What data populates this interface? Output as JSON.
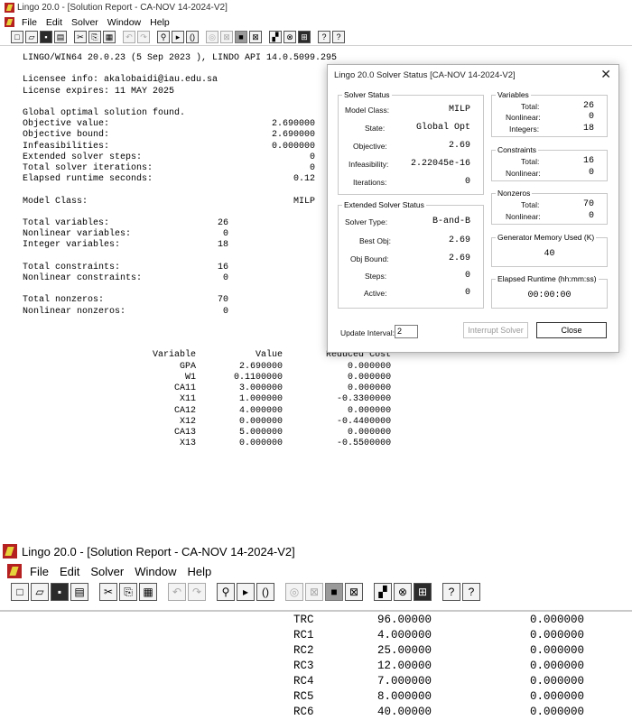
{
  "top": {
    "window_title": "Lingo 20.0 - [Solution Report - CA-NOV 14-2024-V2]",
    "menu": [
      "File",
      "Edit",
      "Solver",
      "Window",
      "Help"
    ],
    "report_lines": [
      "LINGO/WIN64 20.0.23 (5 Sep 2023 ), LINDO API 14.0.5099.295",
      "",
      "Licensee info: akalobaidi@iau.edu.sa",
      "License expires: 11 MAY 2025",
      "",
      "Global optimal solution found.",
      "Objective value:                              2.690000",
      "Objective bound:                              2.690000",
      "Infeasibilities:                              0.000000",
      "Extended solver steps:                               0",
      "Total solver iterations:                             0",
      "Elapsed runtime seconds:                          0.12",
      "",
      "Model Class:                                      MILP",
      "",
      "Total variables:                    26",
      "Nonlinear variables:                 0",
      "Integer variables:                  18",
      "",
      "Total constraints:                  16",
      "Nonlinear constraints:               0",
      "",
      "Total nonzeros:                     70",
      "Nonlinear nonzeros:                  0",
      "",
      "",
      "",
      "                        Variable           Value        Reduced Cost",
      "                             GPA        2.690000            0.000000",
      "                              W1       0.1100000            0.000000",
      "                            CA11        3.000000            0.000000",
      "                             X11        1.000000          -0.3300000",
      "                            CA12        4.000000            0.000000",
      "                             X12        0.000000          -0.4400000",
      "                            CA13        5.000000            0.000000",
      "                             X13        0.000000          -0.5500000"
    ]
  },
  "dialog": {
    "title": "Lingo 20.0 Solver Status [CA-NOV 14-2024-V2]",
    "close_glyph": "✕",
    "solver_status": {
      "legend": "Solver Status",
      "model_class_label": "Model Class:",
      "model_class": "MILP",
      "state_label": "State:",
      "state": "Global Opt",
      "objective_label": "Objective:",
      "objective": "2.69",
      "infeasibility_label": "Infeasibility:",
      "infeasibility": "2.22045e-16",
      "iterations_label": "Iterations:",
      "iterations": "0"
    },
    "extended": {
      "legend": "Extended Solver Status",
      "solver_type_label": "Solver Type:",
      "solver_type": "B-and-B",
      "best_obj_label": "Best Obj:",
      "best_obj": "2.69",
      "obj_bound_label": "Obj Bound:",
      "obj_bound": "2.69",
      "steps_label": "Steps:",
      "steps": "0",
      "active_label": "Active:",
      "active": "0"
    },
    "variables": {
      "legend": "Variables",
      "total_label": "Total:",
      "total": "26",
      "nonlinear_label": "Nonlinear:",
      "nonlinear": "0",
      "integers_label": "Integers:",
      "integers": "18"
    },
    "constraints": {
      "legend": "Constraints",
      "total_label": "Total:",
      "total": "16",
      "nonlinear_label": "Nonlinear:",
      "nonlinear": "0"
    },
    "nonzeros": {
      "legend": "Nonzeros",
      "total_label": "Total:",
      "total": "70",
      "nonlinear_label": "Nonlinear:",
      "nonlinear": "0"
    },
    "memory": {
      "legend": "Generator Memory Used (K)",
      "value": "40"
    },
    "runtime": {
      "legend": "Elapsed Runtime (hh:mm:ss)",
      "value": "00:00:00"
    },
    "update_interval_label": "Update Interval:",
    "update_interval": "2",
    "interrupt_label": "Interrupt Solver",
    "close_label": "Close"
  },
  "bottom": {
    "window_title": "Lingo 20.0 - [Solution Report - CA-NOV 14-2024-V2]",
    "menu": [
      "File",
      "Edit",
      "Solver",
      "Window",
      "Help"
    ],
    "rows": [
      {
        "name": "TRC",
        "value": "96.00000",
        "cost": "0.000000"
      },
      {
        "name": "RC1",
        "value": "4.000000",
        "cost": "0.000000"
      },
      {
        "name": "RC2",
        "value": "25.00000",
        "cost": "0.000000"
      },
      {
        "name": "RC3",
        "value": "12.00000",
        "cost": "0.000000"
      },
      {
        "name": "RC4",
        "value": "7.000000",
        "cost": "0.000000"
      },
      {
        "name": "RC5",
        "value": "8.000000",
        "cost": "0.000000"
      },
      {
        "name": "RC6",
        "value": "40.00000",
        "cost": "0.000000"
      }
    ]
  },
  "toolbar_icons": [
    "new-file-icon",
    "open-folder-icon",
    "save-icon",
    "print-icon",
    "sep",
    "cut-icon",
    "copy-icon",
    "paste-icon",
    "sep",
    "undo-icon",
    "redo-icon",
    "sep",
    "find-icon",
    "goto-line-icon",
    "match-paren-icon",
    "sep",
    "solve-icon",
    "close-all-icon",
    "stop-icon",
    "send-to-back-icon",
    "sep",
    "tile-icon",
    "close-window-icon",
    "arrange-icon",
    "sep",
    "help-icon",
    "context-help-icon"
  ]
}
